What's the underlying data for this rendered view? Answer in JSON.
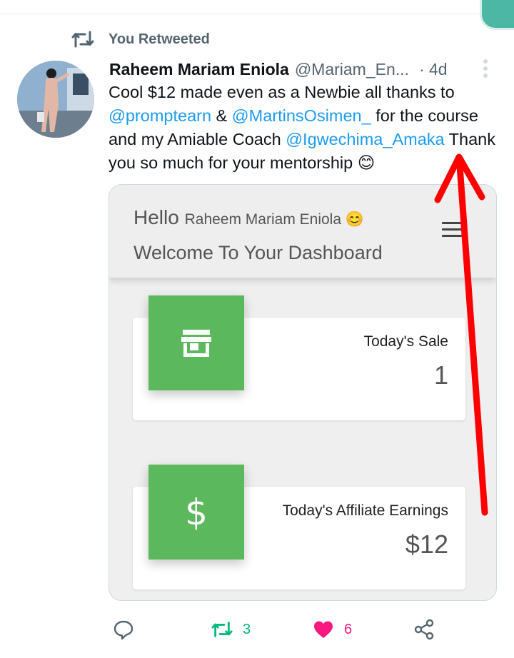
{
  "retweet_banner": {
    "label": "You Retweeted"
  },
  "tweet": {
    "author": "Raheem Mariam Eniola",
    "handle": "@Mariam_En...",
    "time": "· 4d",
    "text_parts": {
      "p1": "Cool $12 made even as a Newbie all thanks to",
      "m1": "@promptearn",
      "p2": " & ",
      "m2": "@MartinsOsimen_",
      "p3": " for the course and my Amiable Coach ",
      "m3": "@Igwechima_Amaka",
      "p4": " Thank you so much for your mentorship 😊"
    }
  },
  "dashboard": {
    "hello": "Hello",
    "hello_name": "Raheem Mariam Eniola 😊",
    "welcome": "Welcome To Your Dashboard",
    "stats": [
      {
        "label": "Today's Sale",
        "value": "1",
        "icon": "store-icon"
      },
      {
        "label": "Today's Affiliate Earnings",
        "value": "$12",
        "icon": "dollar-icon"
      }
    ]
  },
  "actions": {
    "reply_count": "",
    "retweet_count": "3",
    "like_count": "6"
  },
  "colors": {
    "mention": "#1d9bf0",
    "retweet_active": "#00ba7c",
    "like_active": "#f91880",
    "dashboard_green": "#5cb85c",
    "annotation_arrow": "#ff0000"
  }
}
